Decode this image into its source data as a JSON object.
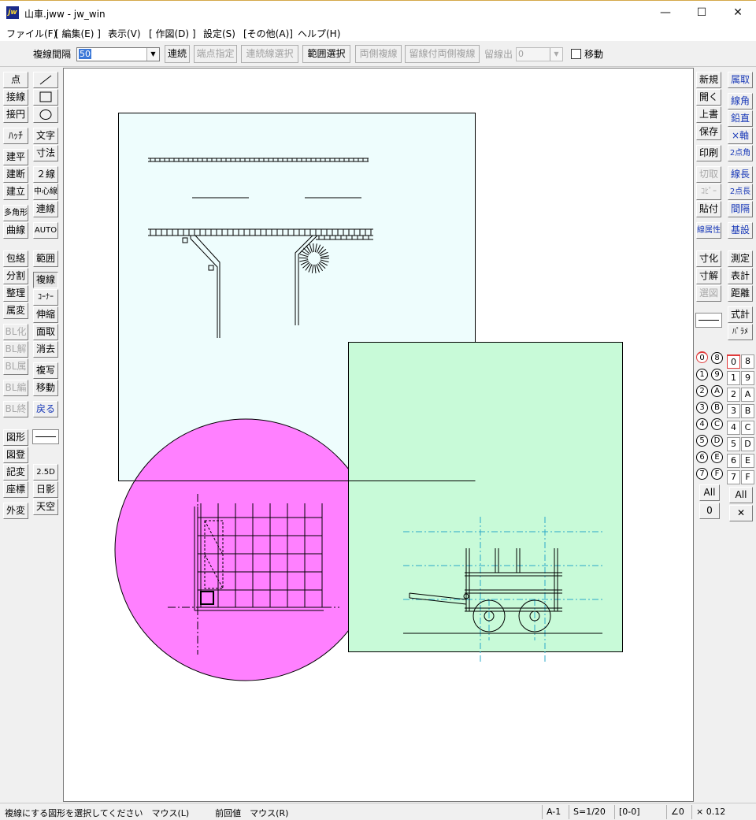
{
  "window": {
    "icon_text": "jw",
    "title": "山車.jww - jw_win",
    "minimize": "—",
    "maximize": "☐",
    "close": "✕"
  },
  "menu": [
    "ファイル(F)",
    "[ 編集(E) ]",
    "表示(V)",
    "[ 作図(D) ]",
    "設定(S)",
    "[その他(A)]",
    "ヘルプ(H)"
  ],
  "toolbar": {
    "spacing_label": "複線間隔",
    "spacing_value": "50",
    "buttons": [
      "連続",
      "端点指定",
      "連続線選択",
      "範囲選択",
      "両側複線",
      "留線付両側複線"
    ],
    "tome_label": "留線出",
    "tome_value": "0",
    "move_label": "移動"
  },
  "left_tools": {
    "col1": [
      "点",
      "接線",
      "接円",
      "ﾊｯﾁ",
      "建平",
      "建断",
      "建立",
      "多角形",
      "曲線",
      "包絡",
      "分割",
      "整理",
      "属変",
      "BL化",
      "BL解",
      "BL属",
      "BL編",
      "BL終",
      "図形",
      "図登",
      "記変",
      "座標",
      "外変"
    ],
    "col2_text": [
      "文字",
      "寸法",
      "２線",
      "中心線",
      "連線",
      "AUTO",
      "範囲",
      "複線",
      "ｺｰﾅｰ",
      "伸縮",
      "面取",
      "消去",
      "複写",
      "移動",
      "戻る",
      "2.5D",
      "日影",
      "天空"
    ]
  },
  "right_tools": {
    "col1": [
      "新規",
      "開く",
      "上書",
      "保存",
      "印刷",
      "切取",
      "ｺﾋﾟｰ",
      "貼付",
      "線属性",
      "寸化",
      "寸解",
      "選図"
    ],
    "col2": [
      "属取",
      "線角",
      "鉛直",
      "×軸",
      "2点角",
      "線長",
      "2点長",
      "間隔",
      "基設",
      "測定",
      "表計",
      "距離",
      "式計",
      "ﾊﾟﾗﾒ"
    ],
    "layer_groups": [
      "0",
      "1",
      "2",
      "3",
      "4",
      "5",
      "6",
      "7"
    ],
    "layer_groups_hi": [
      "8",
      "9",
      "A",
      "B",
      "C",
      "D",
      "E",
      "F"
    ],
    "layers": [
      "0",
      "1",
      "2",
      "3",
      "4",
      "5",
      "6",
      "7"
    ],
    "layers_hi": [
      "8",
      "9",
      "A",
      "B",
      "C",
      "D",
      "E",
      "F"
    ],
    "all_label": "All",
    "zero_label": "0",
    "x_label": "✕"
  },
  "status": {
    "message": "複線にする図形を選択してください　マウス(L)　　　前回値　マウス(R)",
    "layer": "A-1",
    "scale": "S=1/20",
    "group": "[0-0]",
    "angle": "∠0",
    "zoom": "× 0.12"
  },
  "colors": {
    "blue_panel": "#eefdfd",
    "green_panel": "#c8fad8",
    "magenta_circle": "#ff80ff",
    "cyan_line": "#2aa8c8",
    "highlight_layer": "#e03a3a"
  }
}
